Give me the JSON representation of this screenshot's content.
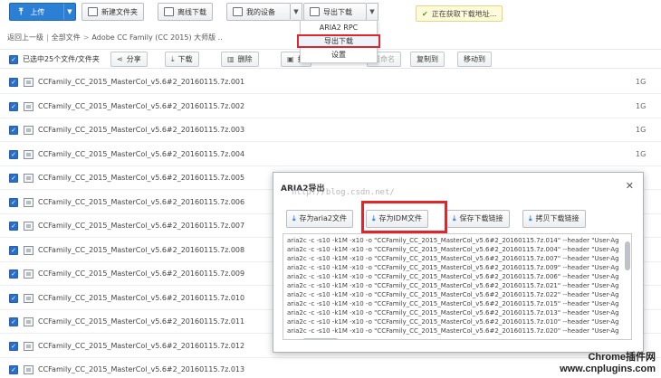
{
  "toolbar": {
    "upload_label": "上传",
    "new_folder_label": "新建文件夹",
    "offline_download_label": "离线下载",
    "my_device_label": "我的设备",
    "export_download_label": "导出下载"
  },
  "toast": {
    "text": "正在获取下载地址..."
  },
  "export_menu": {
    "items": [
      {
        "label": "ARIA2 RPC"
      },
      {
        "label": "导出下载"
      },
      {
        "label": "设置"
      }
    ]
  },
  "breadcrumb": {
    "back": "返回上一级",
    "all_files": "全部文件",
    "current": "Adobe CC Family (CC 2015) 大师版 .."
  },
  "actionbar": {
    "selected_text": "已选中25个文件/文件夹",
    "share": "分享",
    "download": "下载",
    "delete": "删除",
    "push_partial": "推",
    "rename": "重命名",
    "copy_to": "复制到",
    "move_to": "移动到"
  },
  "files": [
    {
      "name": "CCFamily_CC_2015_MasterCol_v5.6#2_20160115.7z.001",
      "size": "1G"
    },
    {
      "name": "CCFamily_CC_2015_MasterCol_v5.6#2_20160115.7z.002",
      "size": "1G"
    },
    {
      "name": "CCFamily_CC_2015_MasterCol_v5.6#2_20160115.7z.003",
      "size": "1G"
    },
    {
      "name": "CCFamily_CC_2015_MasterCol_v5.6#2_20160115.7z.004",
      "size": "1G"
    },
    {
      "name": "CCFamily_CC_2015_MasterCol_v5.6#2_20160115.7z.005",
      "size": ""
    },
    {
      "name": "CCFamily_CC_2015_MasterCol_v5.6#2_20160115.7z.006",
      "size": ""
    },
    {
      "name": "CCFamily_CC_2015_MasterCol_v5.6#2_20160115.7z.007",
      "size": ""
    },
    {
      "name": "CCFamily_CC_2015_MasterCol_v5.6#2_20160115.7z.008",
      "size": ""
    },
    {
      "name": "CCFamily_CC_2015_MasterCol_v5.6#2_20160115.7z.009",
      "size": ""
    },
    {
      "name": "CCFamily_CC_2015_MasterCol_v5.6#2_20160115.7z.010",
      "size": ""
    },
    {
      "name": "CCFamily_CC_2015_MasterCol_v5.6#2_20160115.7z.011",
      "size": ""
    },
    {
      "name": "CCFamily_CC_2015_MasterCol_v5.6#2_20160115.7z.012",
      "size": ""
    },
    {
      "name": "CCFamily_CC_2015_MasterCol_v5.6#2_20160115.7z.013",
      "size": ""
    }
  ],
  "dialog": {
    "title": "ARIA2导出",
    "watermark": "http://blog.csdn.net/",
    "btn_save_aria2": "存为aria2文件",
    "btn_save_idm": "存为IDM文件",
    "btn_save_links": "保存下载链接",
    "btn_copy_links": "拷贝下载链接",
    "lines": [
      "aria2c -c -s10 -k1M -x10 -o \"CCFamily_CC_2015_MasterCol_v5.6#2_20160115.7z.014\" --header \"User-Ag",
      "aria2c -c -s10 -k1M -x10 -o \"CCFamily_CC_2015_MasterCol_v5.6#2_20160115.7z.004\" --header \"User-Ag",
      "aria2c -c -s10 -k1M -x10 -o \"CCFamily_CC_2015_MasterCol_v5.6#2_20160115.7z.007\" --header \"User-Ag",
      "aria2c -c -s10 -k1M -x10 -o \"CCFamily_CC_2015_MasterCol_v5.6#2_20160115.7z.009\" --header \"User-Ag",
      "aria2c -c -s10 -k1M -x10 -o \"CCFamily_CC_2015_MasterCol_v5.6#2_20160115.7z.006\" --header \"User-Ag",
      "aria2c -c -s10 -k1M -x10 -o \"CCFamily_CC_2015_MasterCol_v5.6#2_20160115.7z.021\" --header \"User-Ag",
      "aria2c -c -s10 -k1M -x10 -o \"CCFamily_CC_2015_MasterCol_v5.6#2_20160115.7z.022\" --header \"User-Ag",
      "aria2c -c -s10 -k1M -x10 -o \"CCFamily_CC_2015_MasterCol_v5.6#2_20160115.7z.015\" --header \"User-Ag",
      "aria2c -c -s10 -k1M -x10 -o \"CCFamily_CC_2015_MasterCol_v5.6#2_20160115.7z.013\" --header \"User-Ag",
      "aria2c -c -s10 -k1M -x10 -o \"CCFamily_CC_2015_MasterCol_v5.6#2_20160115.7z.010\" --header \"User-Ag",
      "aria2c -c -s10 -k1M -x10 -o \"CCFamily_CC_2015_MasterCol_v5.6#2_20160115.7z.020\" --header \"User-Ag"
    ]
  },
  "branding": {
    "line1": "Chrome插件网",
    "line2": "www.cnplugins.com"
  }
}
